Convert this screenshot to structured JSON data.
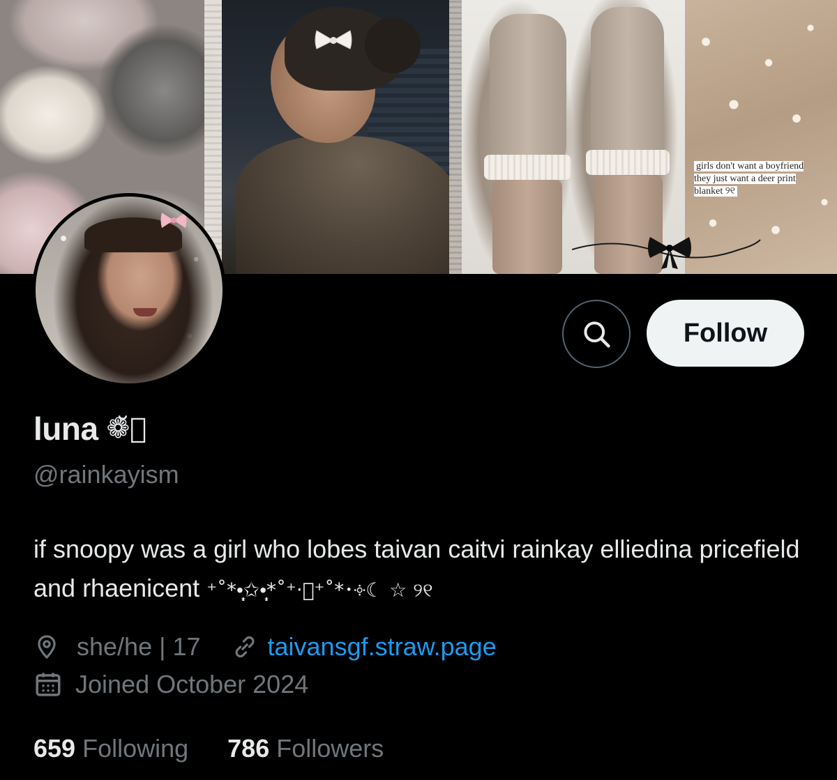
{
  "profile": {
    "display_name": "luna",
    "name_decoration": "❁̆⃝",
    "handle": "@rainkayism",
    "bio_text": "if snoopy was a girl who lobes taivan caitvi rainkay elliedina pricefield and rhaenicent",
    "bio_decoration": "⁺˚*•̩̩͙✩•̩̩͙*˚⁺‧͙⁺˚*･༓☾ ☆ ୨୧",
    "location": "she/he | 17",
    "website": "taivansgf.straw.page",
    "joined": "Joined October 2024",
    "following_count": "659",
    "following_label": "Following",
    "followers_count": "786",
    "followers_label": "Followers"
  },
  "actions": {
    "follow_label": "Follow"
  },
  "banner": {
    "caption": "girls don't want a boyfriend they just want a deer print blanket ୨୧"
  },
  "icons": {
    "search": "search-icon",
    "location": "location-pin-icon",
    "link": "link-icon",
    "calendar": "calendar-icon"
  },
  "colors": {
    "background": "#000000",
    "primary_text": "#e7e9ea",
    "secondary_text": "#71767b",
    "link": "#1d9bf0",
    "follow_button_bg": "#eff3f4",
    "follow_button_text": "#0f1419",
    "search_button_border": "#536471"
  }
}
